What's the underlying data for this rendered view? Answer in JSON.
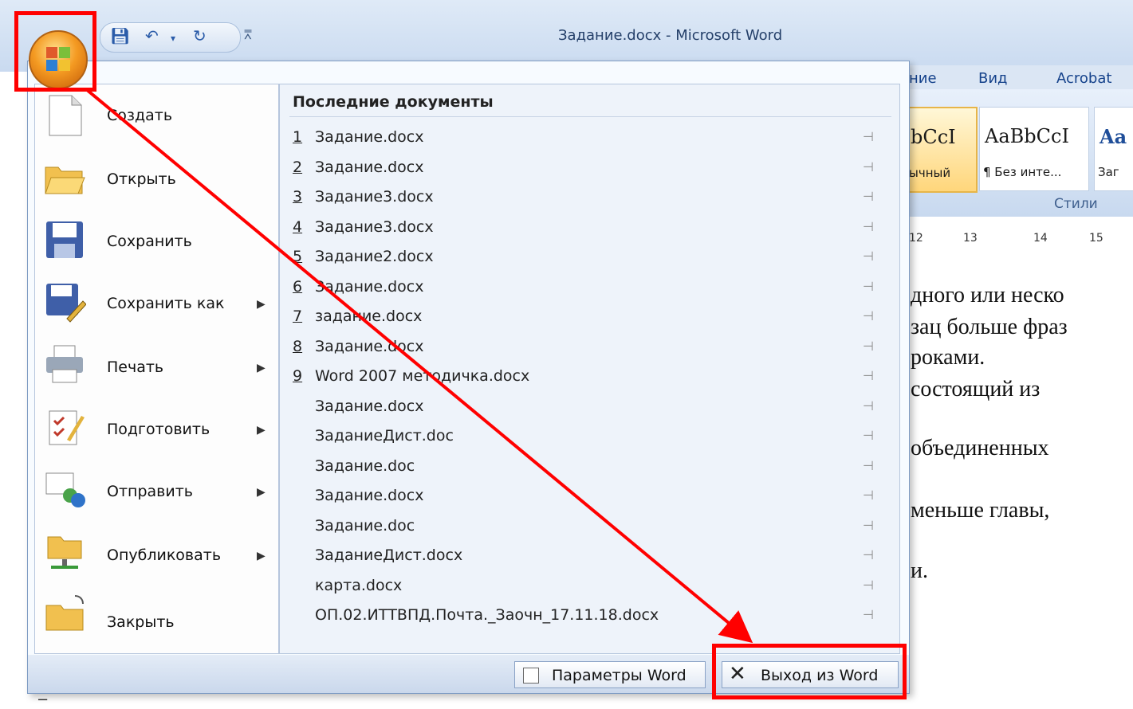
{
  "window": {
    "title": "Задание.docx - Microsoft Word"
  },
  "ribbon": {
    "tabs": [
      "ние",
      "Вид",
      "Acrobat"
    ],
    "styles": [
      {
        "sample": "bCcI",
        "name": "ычный"
      },
      {
        "sample": "AaBbCcI",
        "name": "¶ Без инте..."
      },
      {
        "sample": "Aa",
        "name": "Заг"
      }
    ],
    "styles_label": "Стили",
    "ruler_marks": [
      "12",
      "13",
      "14",
      "15"
    ]
  },
  "document": {
    "lines": [
      "дного или неско",
      "зац больше фраз",
      "роками.",
      "состоящий из",
      "объединенных",
      "меньше главы,",
      "и."
    ]
  },
  "office_menu": {
    "commands": [
      {
        "label": "Создать",
        "has_submenu": false
      },
      {
        "label": "Открыть",
        "has_submenu": false
      },
      {
        "label": "Сохранить",
        "has_submenu": false
      },
      {
        "label": "Сохранить как",
        "has_submenu": true
      },
      {
        "label": "Печать",
        "has_submenu": true
      },
      {
        "label": "Подготовить",
        "has_submenu": true
      },
      {
        "label": "Отправить",
        "has_submenu": true
      },
      {
        "label": "Опубликовать",
        "has_submenu": true
      },
      {
        "label": "Закрыть",
        "has_submenu": false
      }
    ],
    "submenu_arrow": "▶",
    "recent_title": "Последние документы",
    "recent": [
      {
        "num": "1",
        "name": "Задание.docx"
      },
      {
        "num": "2",
        "name": "Задание.docx"
      },
      {
        "num": "3",
        "name": "Задание3.docx"
      },
      {
        "num": "4",
        "name": "Задание3.docx"
      },
      {
        "num": "5",
        "name": "Задание2.docx"
      },
      {
        "num": "6",
        "name": "Задание.docx"
      },
      {
        "num": "7",
        "name": "задание.docx"
      },
      {
        "num": "8",
        "name": "Задание.docx"
      },
      {
        "num": "9",
        "name": "Word 2007 методичка.docx"
      },
      {
        "num": "",
        "name": "Задание.docx"
      },
      {
        "num": "",
        "name": "ЗаданиеДист.doc"
      },
      {
        "num": "",
        "name": "Задание.doc"
      },
      {
        "num": "",
        "name": "Задание.docx"
      },
      {
        "num": "",
        "name": "Задание.doc"
      },
      {
        "num": "",
        "name": "ЗаданиеДист.docx"
      },
      {
        "num": "",
        "name": "карта.docx"
      },
      {
        "num": "",
        "name": "ОП.02.ИТТВПД.Почта._Заочн_17.11.18.docx"
      }
    ],
    "pin_glyph": "⊣",
    "params_button": "Параметры Word",
    "exit_button": "Выход из Word"
  },
  "colors": {
    "annotation": "#ff0000",
    "menu_border": "#7f9cc4",
    "accent": "#15428b"
  }
}
